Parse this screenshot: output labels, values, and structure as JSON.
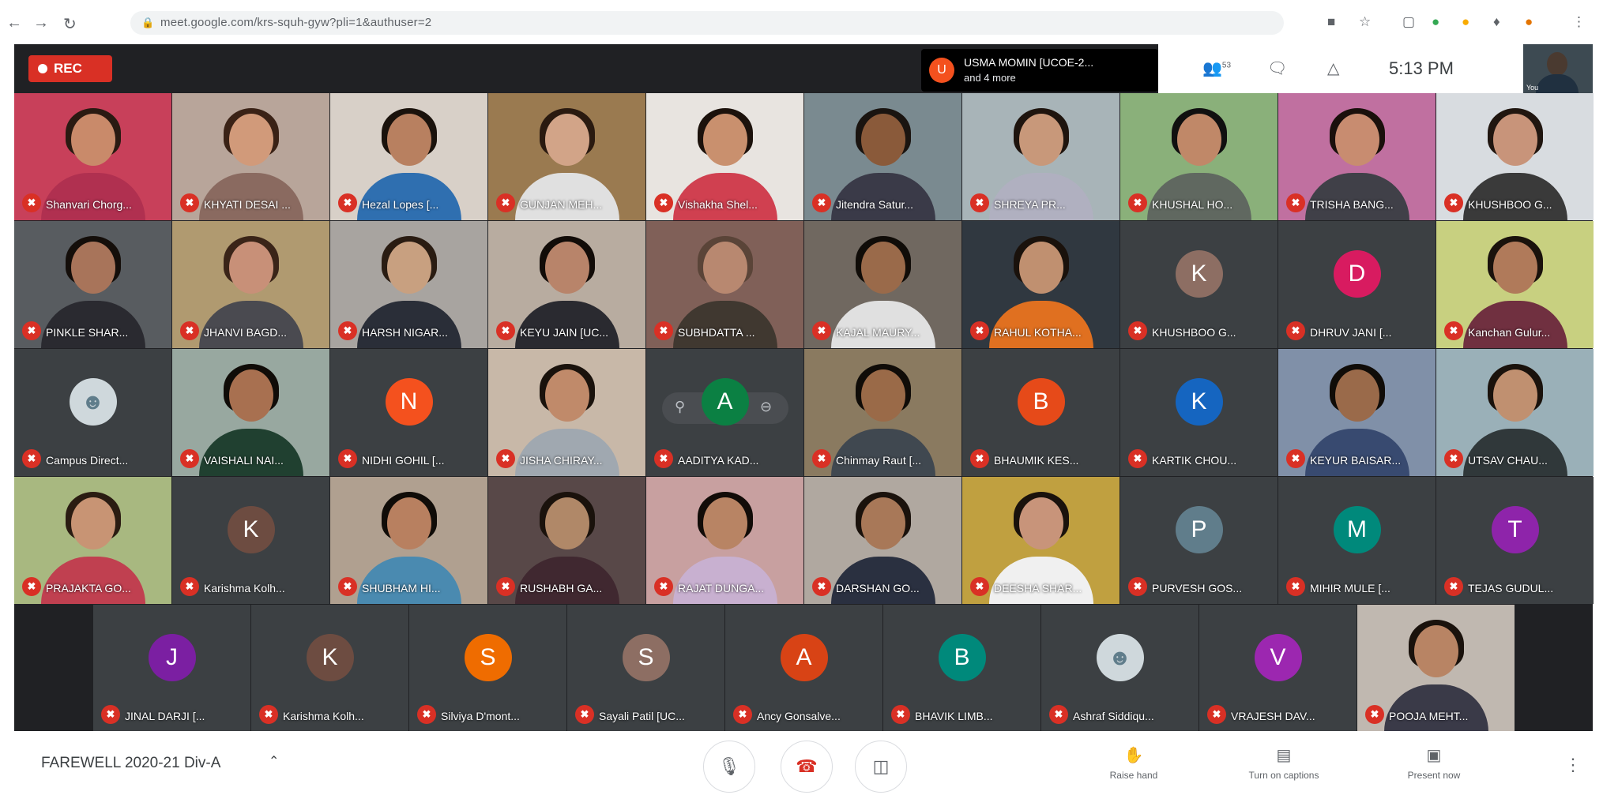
{
  "browser": {
    "url": "meet.google.com/krs-squh-gyw?pli=1&authuser=2",
    "icons": [
      "back-icon",
      "forward-icon",
      "reload-icon",
      "lock-icon"
    ]
  },
  "topbar": {
    "rec_label": "REC",
    "notification": {
      "avatar_letter": "U",
      "line1": "USMA MOMIN [UCOE-2...",
      "line2": "and 4 more"
    },
    "people_count": "53",
    "clock": "5:13 PM",
    "self_view_label": "You"
  },
  "tiles": [
    {
      "name": "Shanvari Chorg...",
      "type": "video",
      "bg": "#c8405a",
      "skin": "#c98a6a",
      "hair": "#2a1a12",
      "shirt": "#b03050"
    },
    {
      "name": "KHYATI DESAI ...",
      "type": "video",
      "bg": "#b8a59a",
      "skin": "#d19a7a",
      "hair": "#3a2216",
      "shirt": "#8a6a60"
    },
    {
      "name": "Hezal Lopes [...",
      "type": "video",
      "bg": "#d8d0c8",
      "skin": "#b88060",
      "hair": "#1a120c",
      "shirt": "#2f6fb0"
    },
    {
      "name": "GUNJAN MEH...",
      "type": "video",
      "bg": "#9a7a50",
      "skin": "#d2a488",
      "hair": "#2a1a10",
      "shirt": "#e0e0e0"
    },
    {
      "name": "Vishakha Shel...",
      "type": "video",
      "bg": "#e8e4e0",
      "skin": "#c9906e",
      "hair": "#1c120c",
      "shirt": "#d04050"
    },
    {
      "name": "Jitendra Satur...",
      "type": "video",
      "bg": "#7a8a90",
      "skin": "#8a5a3a",
      "hair": "#1a1410",
      "shirt": "#3a3a48"
    },
    {
      "name": "SHREYA PR...",
      "type": "video",
      "bg": "#a8b4b8",
      "skin": "#c8987a",
      "hair": "#1e140e",
      "shirt": "#b0b0c0"
    },
    {
      "name": "KHUSHAL HO...",
      "type": "video",
      "bg": "#8ab07a",
      "skin": "#c08868",
      "hair": "#101010",
      "shirt": "#606860"
    },
    {
      "name": "TRISHA BANG...",
      "type": "video",
      "bg": "#c070a0",
      "skin": "#c88c70",
      "hair": "#1a100c",
      "shirt": "#404048"
    },
    {
      "name": "KHUSHBOO G...",
      "type": "video",
      "bg": "#d8dce0",
      "skin": "#c8947a",
      "hair": "#201610",
      "shirt": "#3a3a3a"
    },
    {
      "name": "PINKLE SHAR...",
      "type": "video",
      "bg": "#585c60",
      "skin": "#a8745a",
      "hair": "#140e0a",
      "shirt": "#2a2a30"
    },
    {
      "name": "JHANVI BAGD...",
      "type": "video",
      "bg": "#b09a70",
      "skin": "#c89078",
      "hair": "#3a2418",
      "shirt": "#4a4a50"
    },
    {
      "name": "HARSH NIGAR...",
      "type": "video",
      "bg": "#a8a4a0",
      "skin": "#c8a080",
      "hair": "#2a1c12",
      "shirt": "#2a2e38"
    },
    {
      "name": "KEYU JAIN [UC...",
      "type": "video",
      "bg": "#b8aca0",
      "skin": "#b8846a",
      "hair": "#120c08",
      "shirt": "#2a2a30"
    },
    {
      "name": "SUBHDATTA ...",
      "type": "video",
      "bg": "#806058",
      "skin": "#b88870",
      "hair": "#5a4438",
      "shirt": "#403830"
    },
    {
      "name": "KAJAL MAURY...",
      "type": "video",
      "bg": "#706860",
      "skin": "#9a6a4a",
      "hair": "#100c08",
      "shirt": "#e0e0e0"
    },
    {
      "name": "RAHUL KOTHA...",
      "type": "video",
      "bg": "#303840",
      "skin": "#c09070",
      "hair": "#1a120c",
      "shirt": "#e07020"
    },
    {
      "name": "KHUSHBOO G...",
      "type": "avatar",
      "letter": "K",
      "color": "#8d6e63"
    },
    {
      "name": "DHRUV JANI [...",
      "type": "avatar",
      "letter": "D",
      "color": "#d81b60"
    },
    {
      "name": "Kanchan Gulur...",
      "type": "video",
      "bg": "#c8d080",
      "skin": "#b07a5a",
      "hair": "#1a120c",
      "shirt": "#703040"
    },
    {
      "name": "Campus Direct...",
      "type": "photo-avatar",
      "color": "#cfd8dc"
    },
    {
      "name": "VAISHALI NAI...",
      "type": "video",
      "bg": "#98a8a0",
      "skin": "#a87050",
      "hair": "#100c08",
      "shirt": "#204030"
    },
    {
      "name": "NIDHI GOHIL [...",
      "type": "avatar",
      "letter": "N",
      "color": "#f4511e"
    },
    {
      "name": "JISHA CHIRAY...",
      "type": "video",
      "bg": "#c8b8a8",
      "skin": "#c08a6a",
      "hair": "#1a120c",
      "shirt": "#a0a8b0"
    },
    {
      "name": "AADITYA KAD...",
      "type": "avatar-hover",
      "letter": "A",
      "color": "#0b8043"
    },
    {
      "name": "Chinmay Raut [...",
      "type": "video",
      "bg": "#8a7a60",
      "skin": "#9a6a48",
      "hair": "#100c08",
      "shirt": "#404850"
    },
    {
      "name": "BHAUMIK KES...",
      "type": "avatar",
      "letter": "B",
      "color": "#e64a19"
    },
    {
      "name": "KARTIK CHOU...",
      "type": "avatar",
      "letter": "K",
      "color": "#1565c0"
    },
    {
      "name": "KEYUR BAISAR...",
      "type": "video",
      "bg": "#8090a8",
      "skin": "#9a6a4a",
      "hair": "#100c08",
      "shirt": "#384a70"
    },
    {
      "name": "UTSAV CHAU...",
      "type": "video",
      "bg": "#9ab0b8",
      "skin": "#c09070",
      "hair": "#1a120c",
      "shirt": "#30383a"
    },
    {
      "name": "PRAJAKTA GO...",
      "type": "video",
      "bg": "#a8b880",
      "skin": "#c89474",
      "hair": "#2a1c12",
      "shirt": "#c04050"
    },
    {
      "name": "Karishma Kolh...",
      "type": "avatar",
      "letter": "K",
      "color": "#6d4c41"
    },
    {
      "name": "SHUBHAM HI...",
      "type": "video",
      "bg": "#b0a090",
      "skin": "#b88060",
      "hair": "#100c08",
      "shirt": "#4a8ab0"
    },
    {
      "name": "RUSHABH GA...",
      "type": "video",
      "bg": "#584848",
      "skin": "#b08868",
      "hair": "#1a120c",
      "shirt": "#402830"
    },
    {
      "name": "RAJAT DUNGA...",
      "type": "video",
      "bg": "#c8a0a0",
      "skin": "#b88464",
      "hair": "#120c08",
      "shirt": "#c8b0d0"
    },
    {
      "name": "DARSHAN GO...",
      "type": "video",
      "bg": "#b0a8a0",
      "skin": "#a87858",
      "hair": "#1a120c",
      "shirt": "#2a3040"
    },
    {
      "name": "DEESHA SHAR...",
      "type": "video",
      "bg": "#c0a040",
      "skin": "#c8947a",
      "hair": "#1a120c",
      "shirt": "#f0f0f0"
    },
    {
      "name": "PURVESH GOS...",
      "type": "avatar",
      "letter": "P",
      "color": "#607d8b"
    },
    {
      "name": "MIHIR MULE [...",
      "type": "avatar",
      "letter": "M",
      "color": "#00897b"
    },
    {
      "name": "TEJAS GUDUL...",
      "type": "avatar",
      "letter": "T",
      "color": "#8e24aa"
    },
    {
      "name": "JINAL DARJI [...",
      "type": "avatar",
      "letter": "J",
      "color": "#7b1fa2"
    },
    {
      "name": "Karishma Kolh...",
      "type": "avatar",
      "letter": "K",
      "color": "#6d4c41"
    },
    {
      "name": "Silviya D'mont...",
      "type": "avatar",
      "letter": "S",
      "color": "#ef6c00"
    },
    {
      "name": "Sayali Patil [UC...",
      "type": "avatar",
      "letter": "S",
      "color": "#8d6e63"
    },
    {
      "name": "Ancy Gonsalve...",
      "type": "avatar",
      "letter": "A",
      "color": "#d84315"
    },
    {
      "name": "BHAVIK LIMB...",
      "type": "avatar",
      "letter": "B",
      "color": "#00897b"
    },
    {
      "name": "Ashraf Siddiqu...",
      "type": "photo-avatar",
      "color": "#cfd8dc"
    },
    {
      "name": "VRAJESH DAV...",
      "type": "avatar",
      "letter": "V",
      "color": "#9c27b0"
    },
    {
      "name": "POOJA MEHT...",
      "type": "video",
      "bg": "#c0b8b0",
      "skin": "#b88464",
      "hair": "#1a120c",
      "shirt": "#3a3a48"
    }
  ],
  "bottom": {
    "meeting_title": "FAREWELL 2020-21 Div-A",
    "raise_hand": "Raise hand",
    "captions": "Turn on captions",
    "present": "Present now"
  }
}
